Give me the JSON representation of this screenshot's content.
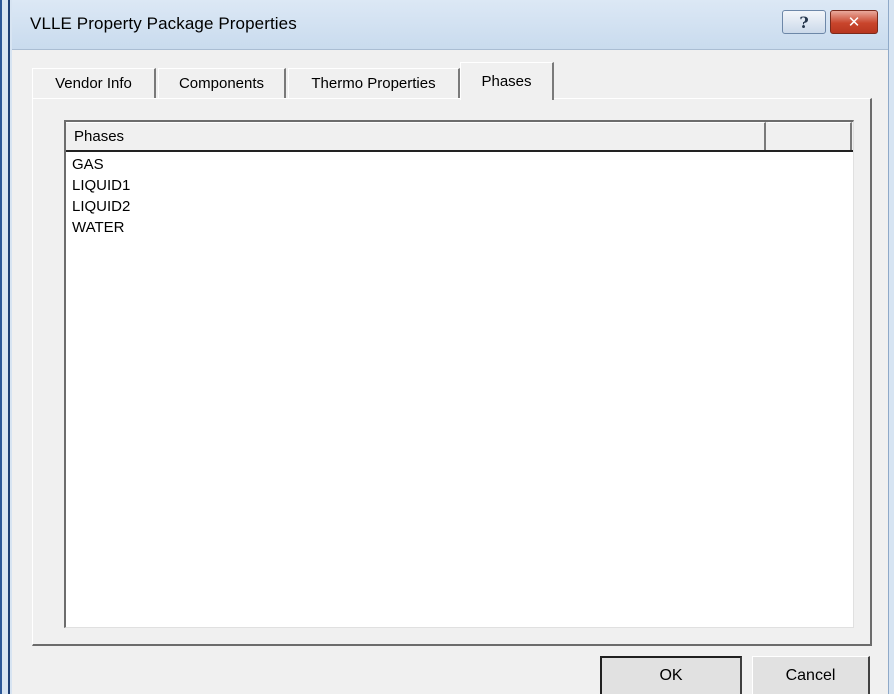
{
  "window": {
    "title": "VLLE Property Package Properties",
    "help_glyph": "?",
    "close_glyph": "✕"
  },
  "tabs": [
    {
      "label": "Vendor Info",
      "active": false
    },
    {
      "label": "Components",
      "active": false
    },
    {
      "label": "Thermo Properties",
      "active": false
    },
    {
      "label": "Phases",
      "active": true
    }
  ],
  "phases_list": {
    "columns": [
      "Phases",
      ""
    ],
    "rows": [
      "GAS",
      "LIQUID1",
      "LIQUID2",
      "WATER"
    ]
  },
  "buttons": {
    "ok_label": "OK",
    "cancel_label": "Cancel"
  },
  "icons": {
    "help": "help-icon",
    "close": "close-icon"
  },
  "colors": {
    "titlebar": "#c9dbee",
    "close_button": "#c9452c",
    "dialog_background": "#f0f0f0",
    "frame_blue": "#2b5797"
  }
}
